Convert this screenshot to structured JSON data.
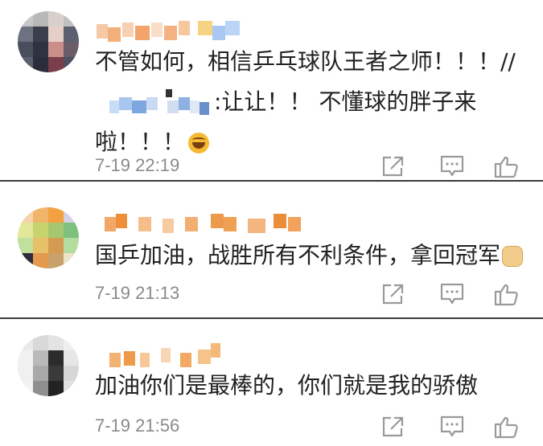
{
  "comments": [
    {
      "text_prefix": "不管如何，相信乒乓球队王者之师！！！//",
      "text_suffix": ":让让！！ 不懂球的胖子来啦！！！",
      "time": "7-19 22:19",
      "emoji": "grin"
    },
    {
      "text": "国乒加油，战胜所有不利条件，拿回冠军",
      "time": "7-19 21:13",
      "emoji": "fist"
    },
    {
      "text": "加油你们是最棒的，你们就是我的骄傲",
      "time": "7-19 21:56"
    }
  ],
  "icons": {
    "share": "share-icon",
    "reply": "comment-icon",
    "like": "thumbs-up-icon"
  },
  "colors": {
    "text": "#222222",
    "meta": "#8a8a8a",
    "icon": "#9a9a9a",
    "divider": "#3a3a3a"
  }
}
